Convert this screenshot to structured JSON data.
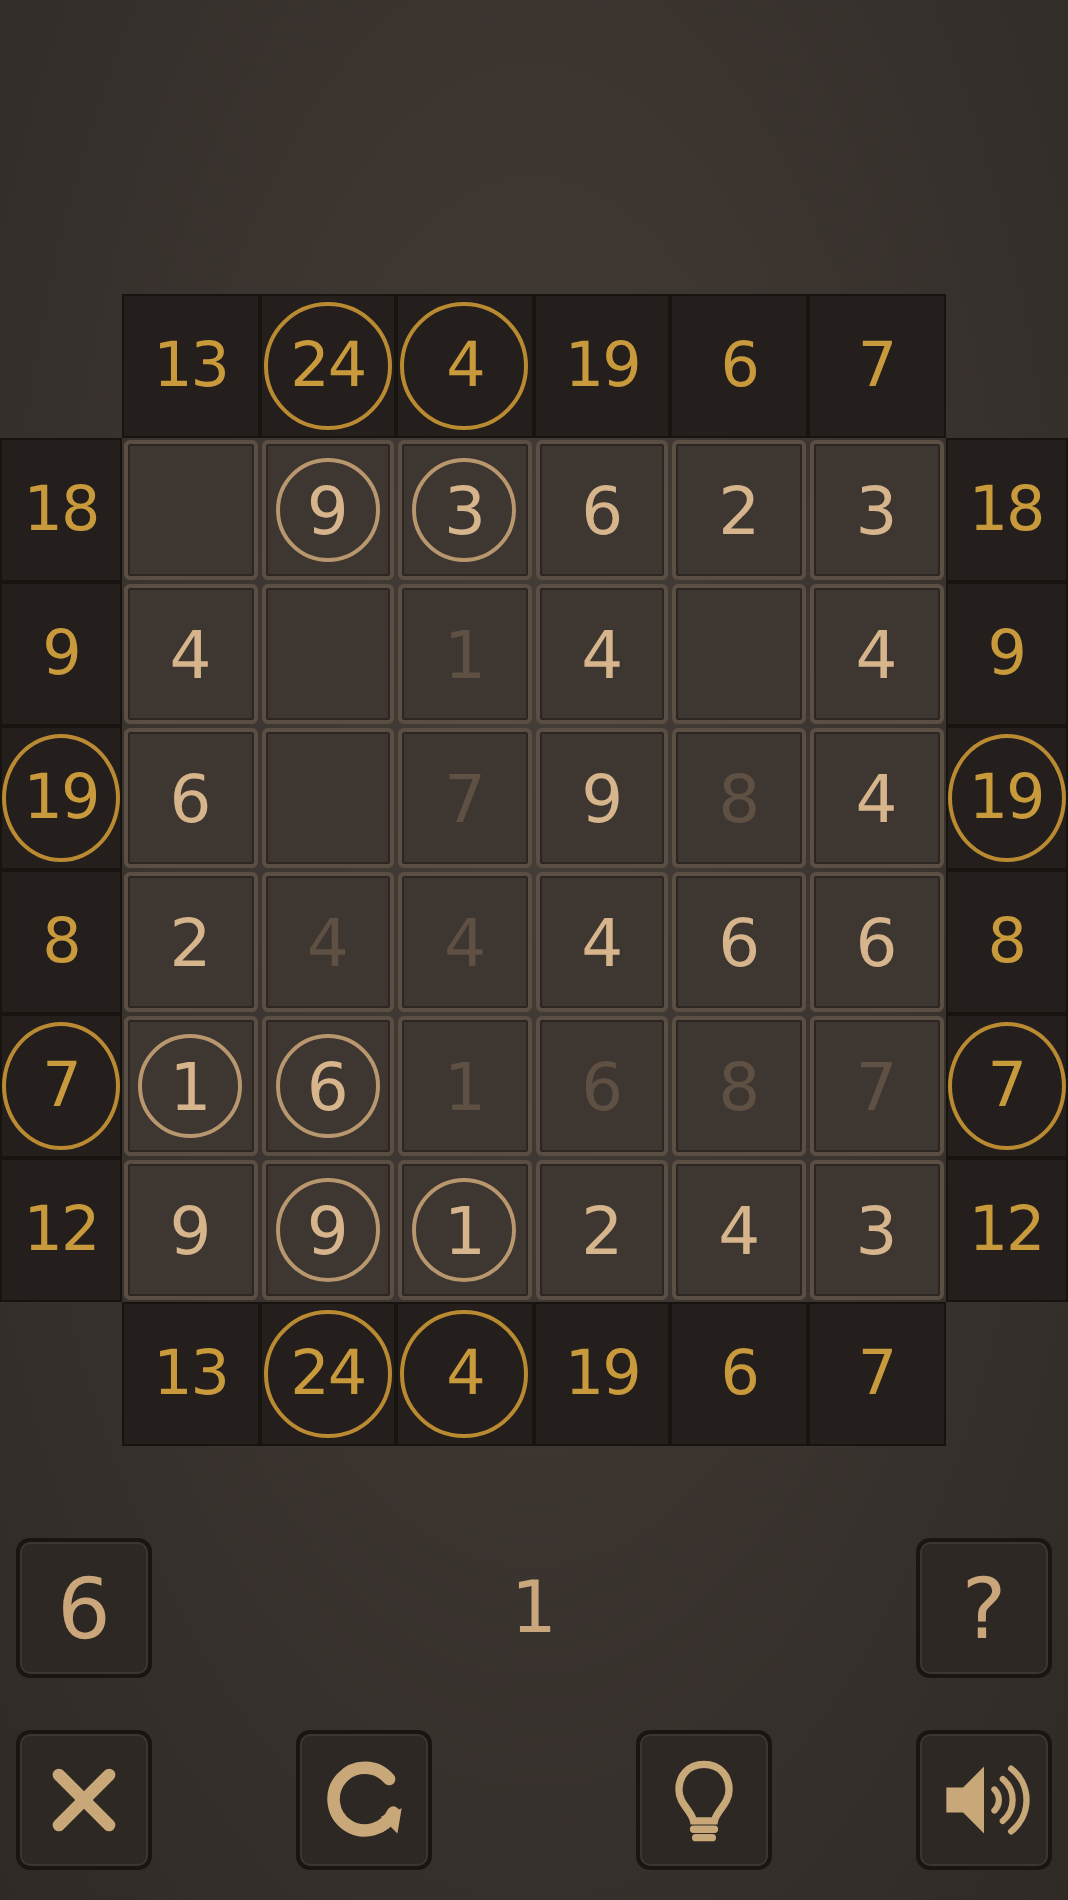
{
  "board": {
    "top_clues": [
      {
        "value": "13",
        "circled": false
      },
      {
        "value": "24",
        "circled": true
      },
      {
        "value": "4",
        "circled": true
      },
      {
        "value": "19",
        "circled": false
      },
      {
        "value": "6",
        "circled": false
      },
      {
        "value": "7",
        "circled": false
      }
    ],
    "rows": [
      {
        "left_clue": {
          "value": "18",
          "circled": false
        },
        "cells": [
          {
            "kind": "blank"
          },
          {
            "kind": "number",
            "value": "9",
            "circled": true,
            "faded": false
          },
          {
            "kind": "number",
            "value": "3",
            "circled": true,
            "faded": false
          },
          {
            "kind": "number",
            "value": "6",
            "circled": false,
            "faded": false
          },
          {
            "kind": "number",
            "value": "2",
            "circled": false,
            "faded": false
          },
          {
            "kind": "number",
            "value": "3",
            "circled": false,
            "faded": false
          }
        ],
        "right_clue": {
          "value": "18",
          "circled": false
        }
      },
      {
        "left_clue": {
          "value": "9",
          "circled": false
        },
        "cells": [
          {
            "kind": "number",
            "value": "4",
            "circled": false,
            "faded": false
          },
          {
            "kind": "blank"
          },
          {
            "kind": "number",
            "value": "1",
            "circled": false,
            "faded": true
          },
          {
            "kind": "number",
            "value": "4",
            "circled": false,
            "faded": false
          },
          {
            "kind": "blank"
          },
          {
            "kind": "number",
            "value": "4",
            "circled": false,
            "faded": false
          }
        ],
        "right_clue": {
          "value": "9",
          "circled": false
        }
      },
      {
        "left_clue": {
          "value": "19",
          "circled": true
        },
        "cells": [
          {
            "kind": "number",
            "value": "6",
            "circled": false,
            "faded": false
          },
          {
            "kind": "blank"
          },
          {
            "kind": "number",
            "value": "7",
            "circled": false,
            "faded": true
          },
          {
            "kind": "number",
            "value": "9",
            "circled": false,
            "faded": false
          },
          {
            "kind": "number",
            "value": "8",
            "circled": false,
            "faded": true
          },
          {
            "kind": "number",
            "value": "4",
            "circled": false,
            "faded": false
          }
        ],
        "right_clue": {
          "value": "19",
          "circled": true
        }
      },
      {
        "left_clue": {
          "value": "8",
          "circled": false
        },
        "cells": [
          {
            "kind": "number",
            "value": "2",
            "circled": false,
            "faded": false
          },
          {
            "kind": "number",
            "value": "4",
            "circled": false,
            "faded": true
          },
          {
            "kind": "number",
            "value": "4",
            "circled": false,
            "faded": true
          },
          {
            "kind": "number",
            "value": "4",
            "circled": false,
            "faded": false
          },
          {
            "kind": "number",
            "value": "6",
            "circled": false,
            "faded": false
          },
          {
            "kind": "number",
            "value": "6",
            "circled": false,
            "faded": false
          }
        ],
        "right_clue": {
          "value": "8",
          "circled": false
        }
      },
      {
        "left_clue": {
          "value": "7",
          "circled": true
        },
        "cells": [
          {
            "kind": "number",
            "value": "1",
            "circled": true,
            "faded": false
          },
          {
            "kind": "number",
            "value": "6",
            "circled": true,
            "faded": false
          },
          {
            "kind": "number",
            "value": "1",
            "circled": false,
            "faded": true
          },
          {
            "kind": "number",
            "value": "6",
            "circled": false,
            "faded": true
          },
          {
            "kind": "number",
            "value": "8",
            "circled": false,
            "faded": true
          },
          {
            "kind": "number",
            "value": "7",
            "circled": false,
            "faded": true
          }
        ],
        "right_clue": {
          "value": "7",
          "circled": true
        }
      },
      {
        "left_clue": {
          "value": "12",
          "circled": false
        },
        "cells": [
          {
            "kind": "number",
            "value": "9",
            "circled": false,
            "faded": false
          },
          {
            "kind": "number",
            "value": "9",
            "circled": true,
            "faded": false
          },
          {
            "kind": "number",
            "value": "1",
            "circled": true,
            "faded": false
          },
          {
            "kind": "number",
            "value": "2",
            "circled": false,
            "faded": false
          },
          {
            "kind": "number",
            "value": "4",
            "circled": false,
            "faded": false
          },
          {
            "kind": "number",
            "value": "3",
            "circled": false,
            "faded": false
          }
        ],
        "right_clue": {
          "value": "12",
          "circled": false
        }
      }
    ],
    "bottom_clues": [
      {
        "value": "13",
        "circled": false
      },
      {
        "value": "24",
        "circled": true
      },
      {
        "value": "4",
        "circled": true
      },
      {
        "value": "19",
        "circled": false
      },
      {
        "value": "6",
        "circled": false
      },
      {
        "value": "7",
        "circled": false
      }
    ]
  },
  "controls": {
    "size_button": "6",
    "counter": "1",
    "help_button": "?",
    "tools": [
      {
        "kind": "close"
      },
      {
        "kind": "restart"
      },
      {
        "kind": "hint"
      },
      {
        "kind": "sound"
      }
    ]
  }
}
